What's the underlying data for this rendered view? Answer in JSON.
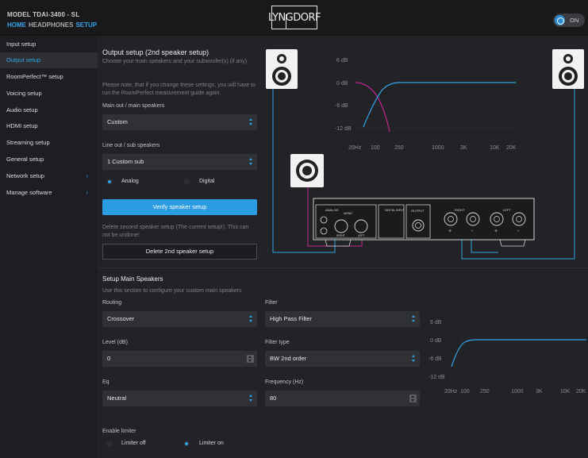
{
  "header": {
    "model": "MODEL TDAI-3400 - SL",
    "nav": [
      "HOME",
      "HEADPHONES",
      "SETUP"
    ],
    "logo": "LYNGDORF",
    "power_toggle": {
      "label": "ON",
      "state": "on"
    }
  },
  "sidebar": {
    "items": [
      {
        "label": "Input setup"
      },
      {
        "label": "Output setup",
        "selected": true
      },
      {
        "label": "RoomPerfect™ setup"
      },
      {
        "label": "Voicing setup"
      },
      {
        "label": "Audio setup"
      },
      {
        "label": "HDMI setup"
      },
      {
        "label": "Streaming setup"
      },
      {
        "label": "General setup"
      },
      {
        "label": "Network setup",
        "chevron": "›"
      },
      {
        "label": "Manage software",
        "chevron": "›"
      }
    ]
  },
  "output": {
    "title": "Output setup (2nd speaker setup)",
    "subtitle": "Choose your main speakers and your subwoofer(s) (if any).",
    "note": "Please note, that if you change these settings, you will have to run the RoomPerfect measurement guide again.",
    "main_out_label": "Main out / main speakers",
    "main_out_value": "Custom",
    "line_out_label": "Line out / sub speakers",
    "line_out_value": "1 Custom sub",
    "radio_analog": "Analog",
    "radio_digital": "Digital",
    "verify_button": "Verify speaker setup",
    "delete_note": "Delete second speaker setup (The current setup!). This can not be undone!",
    "delete_button": "Delete 2nd speaker setup"
  },
  "top_graph": {
    "y_labels": [
      "6 dB",
      "0 dB",
      "-6 dB",
      "-12 dB"
    ],
    "x_labels": [
      "20Hz",
      "100",
      "250",
      "1000",
      "3K",
      "10K",
      "20K"
    ]
  },
  "amp_panel": {
    "analog": "ANALOG",
    "mono": "MONO",
    "right_small": "RIGHT",
    "left_small": "LEFT",
    "digital_input": "DIGITAL INPUT",
    "output": "OUTPUT",
    "right": "RIGHT",
    "left": "LEFT",
    "plus": "+",
    "minus": "-"
  },
  "main_speakers": {
    "title": "Setup Main Speakers",
    "desc": "Use this section to configure your custom main speakers",
    "routing_label": "Routing",
    "routing_value": "Crossover",
    "filter_label": "Filter",
    "filter_value": "High Pass Filter",
    "level_label": "Level (dB)",
    "level_value": "0",
    "filter_type_label": "Filter type",
    "filter_type_value": "BW 2nd order",
    "eq_label": "Eq",
    "eq_value": "Neutral",
    "frequency_label": "Frequency (Hz)",
    "frequency_value": "80",
    "limiter_label": "Enable limiter",
    "limiter_off": "Limiter off",
    "limiter_on": "Limiter on"
  },
  "bottom_graph": {
    "y_labels": [
      "6 dB",
      "0 dB",
      "-6 dB",
      "-12 dB"
    ],
    "x_labels": [
      "20Hz",
      "100",
      "250",
      "1000",
      "3K",
      "10K",
      "20K"
    ]
  },
  "colors": {
    "accent": "#2fa4e7",
    "magenta": "#c2248f",
    "panel": "#2f3135"
  }
}
